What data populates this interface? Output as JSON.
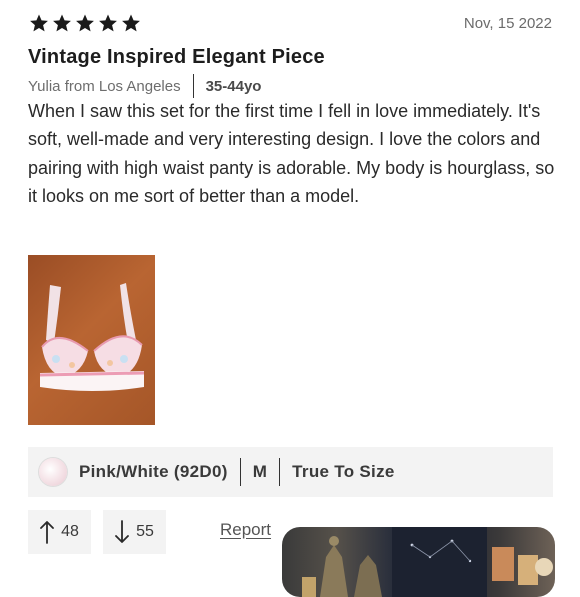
{
  "review": {
    "rating": 5,
    "max_rating": 5,
    "date": "Nov, 15 2022",
    "title": "Vintage Inspired Elegant Piece",
    "author": "Yulia from Los Angeles",
    "age": "35-44yo",
    "body": "When I saw this set for the first time I fell in love immediately. It's soft, well-made and very interesting design. I love the colors and pairing with high waist panty is adorable. My body is hourglass, so it looks on me sort of better than a model."
  },
  "attributes": {
    "color": "Pink/White (92D0)",
    "size": "M",
    "fit": "True To Size"
  },
  "votes": {
    "helpful": "48",
    "not_helpful": "55"
  },
  "actions": {
    "report_label": "Report"
  },
  "colors": {
    "star": "#1a1a1a",
    "bar_bg": "#f3f3f3"
  }
}
